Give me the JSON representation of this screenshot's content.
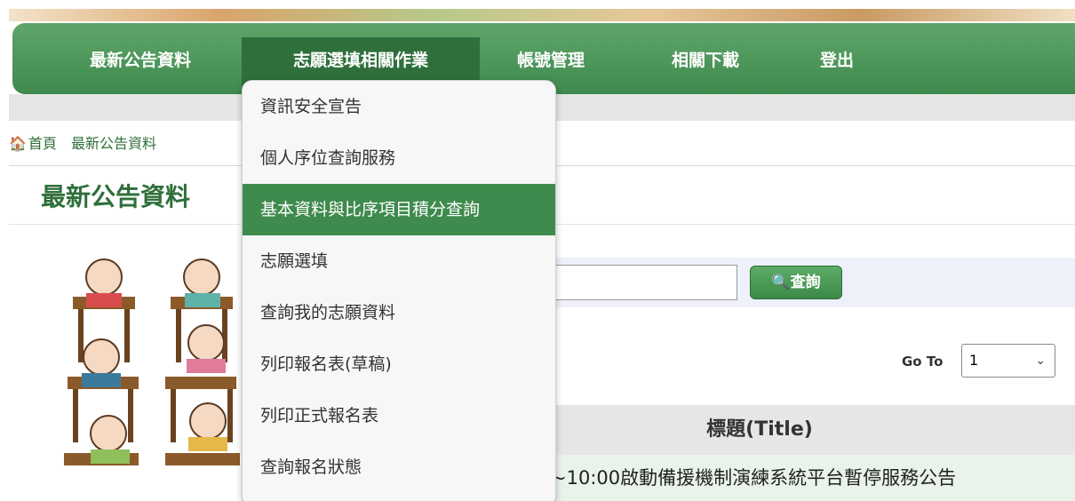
{
  "nav": {
    "items": [
      "最新公告資料",
      "志願選填相關作業",
      "帳號管理",
      "相關下載",
      "登出"
    ]
  },
  "breadcrumb": {
    "home": "首頁",
    "current": "最新公告資料"
  },
  "page": {
    "title": "最新公告資料"
  },
  "search": {
    "button_label": "查詢",
    "input_value": ""
  },
  "pagination": {
    "goto_label": "Go To",
    "page_value": "1"
  },
  "table": {
    "header_title": "標題(Title)",
    "rows": [
      "~10:00啟動備援機制演練系統平台暫停服務公告"
    ]
  },
  "dropdown_menu": {
    "items": [
      "資訊安全宣告",
      "個人序位查詢服務",
      "基本資料與比序項目積分查詢",
      "志願選填",
      "查詢我的志願資料",
      "列印報名表(草稿)",
      "列印正式報名表",
      "查詢報名狀態"
    ]
  },
  "colors": {
    "nav_green": "#4a9557",
    "active_green": "#3f8a4d",
    "title_green": "#2f6f3b"
  }
}
